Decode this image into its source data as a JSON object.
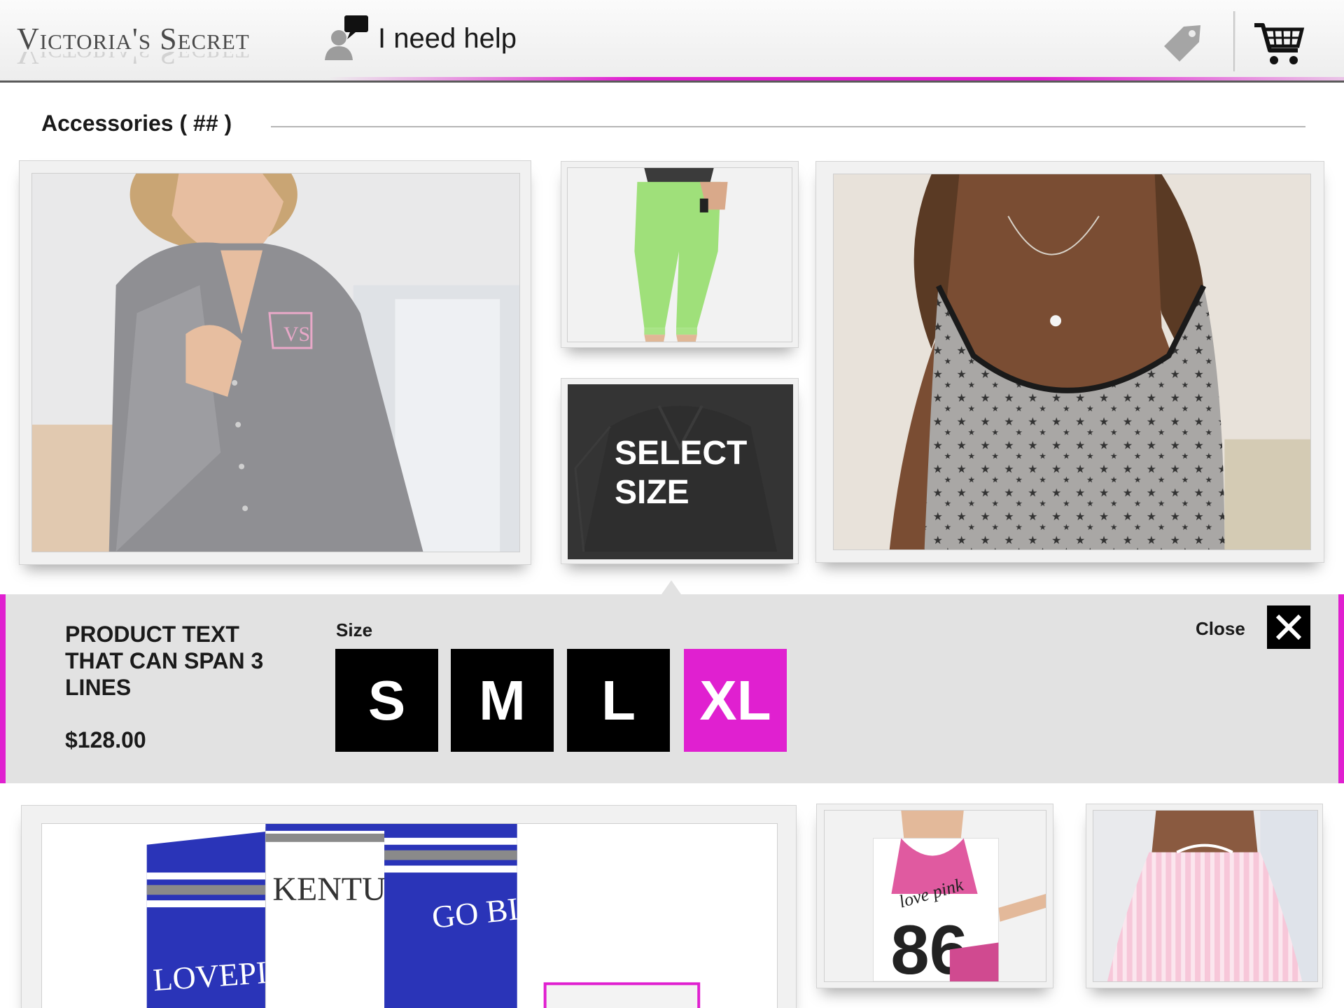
{
  "header": {
    "brand": "Victoria's Secret",
    "help_label": "I need help",
    "icons": [
      "help-chat-icon",
      "price-tag-icon",
      "shopping-cart-icon"
    ],
    "accent_color": "#e020d0"
  },
  "section": {
    "title": "Accessories ( ## )"
  },
  "tiles": {
    "select_size_overlay": "SELECT SIZE",
    "select_size_line1": "SELECT",
    "select_size_line2": "SIZE"
  },
  "panel": {
    "product_text": "PRODUCT TEXT THAT CAN SPAN 3 LINES",
    "price": "$128.00",
    "size_label": "Size",
    "sizes": [
      "S",
      "M",
      "L",
      "XL"
    ],
    "selected_size": "XL",
    "close_label": "Close"
  }
}
